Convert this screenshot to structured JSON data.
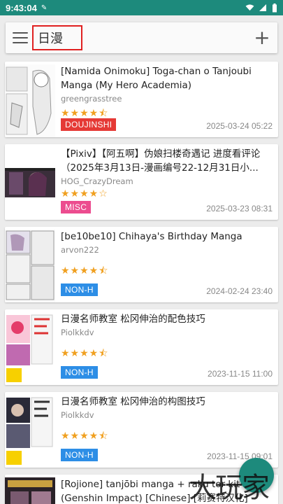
{
  "status_bar": {
    "time": "9:43:04"
  },
  "search": {
    "query": "日漫"
  },
  "items": [
    {
      "title": "[Namida Onimoku] Toga-chan o Tanjoubi Manga (My Hero Academia)",
      "uploader": "greengrasstree",
      "stars": "★★★★⯪",
      "category": "DOUJINSHI",
      "category_color": "#e53935",
      "date": "2025-03-24 05:22"
    },
    {
      "title": "【Pixiv】【阿五啊】伪娘扫楼奇遇记 进度看评论（2025年3月13日-漫画编号22-12月31日小...",
      "uploader": "HOG_CrazyDream",
      "stars": "★★★★☆",
      "category": "MISC",
      "category_color": "#ec4c8f",
      "date": "2025-03-23 08:31"
    },
    {
      "title": "[be10be10] Chihaya's Birthday Manga",
      "uploader": "arvon222",
      "stars": "★★★★⯪",
      "category": "NON-H",
      "category_color": "#2d8ee6",
      "date": "2024-02-24 23:40"
    },
    {
      "title": "日漫名师教室 松冈伸治的配色技巧",
      "uploader": "Piolkkdv",
      "stars": "★★★★⯪",
      "category": "NON-H",
      "category_color": "#2d8ee6",
      "date": "2023-11-15 11:00"
    },
    {
      "title": "日漫名师教室 松冈伸治的构图技巧",
      "uploader": "Piolkkdv",
      "stars": "★★★★⯪",
      "category": "NON-H",
      "category_color": "#2d8ee6",
      "date": "2023-11-15 09:01"
    },
    {
      "title": "[Rojione] tanjōbi manga + raku tor kit + (Genshin Impact) [Chinese] [莉赛特汉化]",
      "uploader": "",
      "stars": "",
      "category": "",
      "category_color": "#2d8ee6",
      "date": ""
    }
  ],
  "watermark": "大玩家"
}
